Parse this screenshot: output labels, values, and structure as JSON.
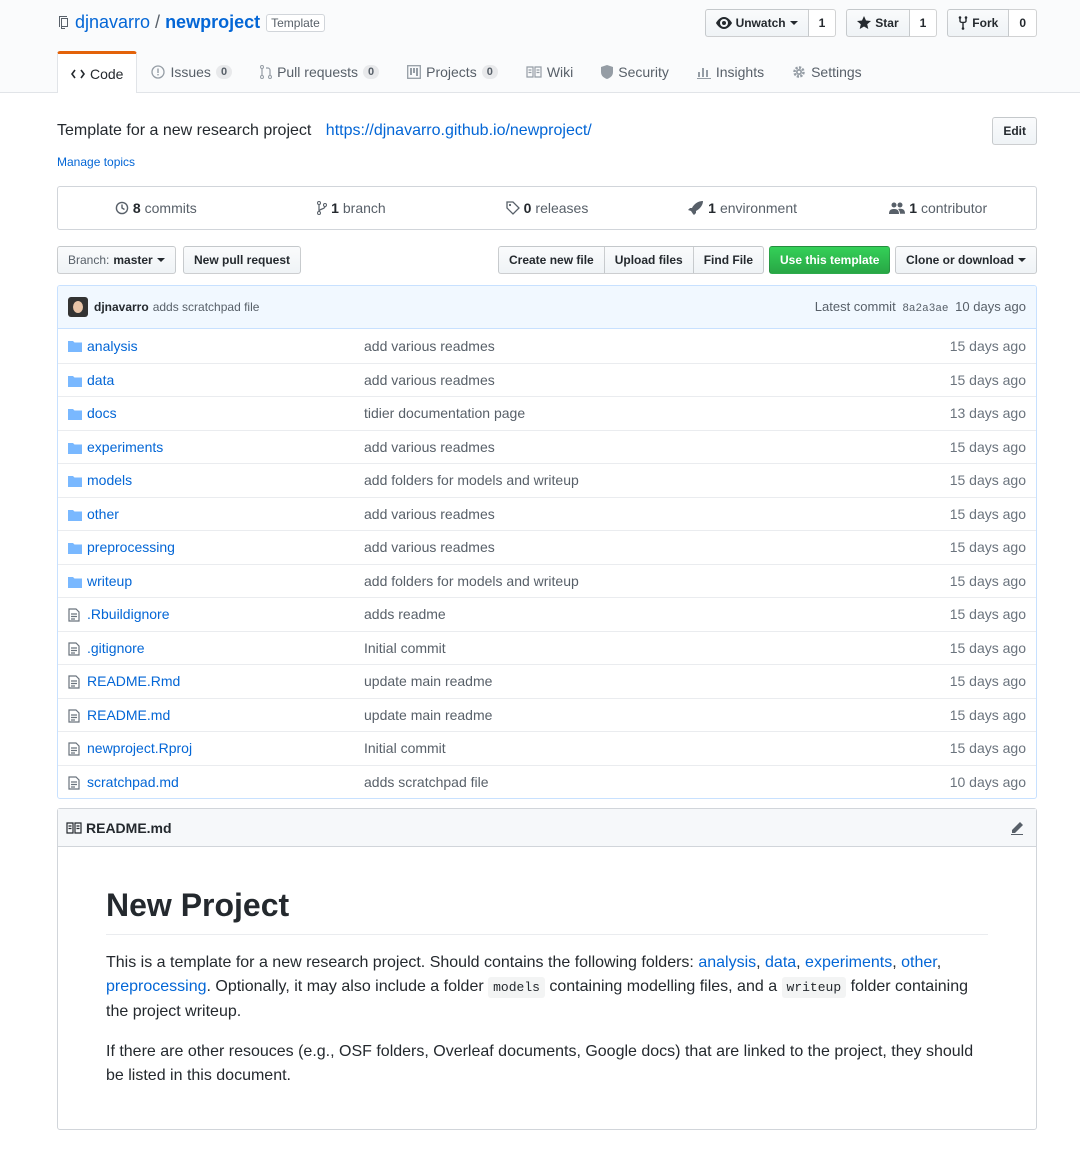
{
  "repo": {
    "owner": "djnavarro",
    "separator": "/",
    "name": "newproject",
    "template_badge": "Template"
  },
  "actions": {
    "watch_label": "Unwatch",
    "watch_count": "1",
    "star_label": "Star",
    "star_count": "1",
    "fork_label": "Fork",
    "fork_count": "0"
  },
  "tabs": [
    {
      "label": "Code",
      "icon": "code-icon"
    },
    {
      "label": "Issues",
      "count": "0",
      "icon": "issue-icon"
    },
    {
      "label": "Pull requests",
      "count": "0",
      "icon": "pull-request-icon"
    },
    {
      "label": "Projects",
      "count": "0",
      "icon": "project-icon"
    },
    {
      "label": "Wiki",
      "icon": "book-icon"
    },
    {
      "label": "Security",
      "icon": "shield-icon"
    },
    {
      "label": "Insights",
      "icon": "graph-icon"
    },
    {
      "label": "Settings",
      "icon": "gear-icon"
    }
  ],
  "about": {
    "description": "Template for a new research project",
    "url": "https://djnavarro.github.io/newproject/",
    "manage_topics": "Manage topics",
    "edit_label": "Edit"
  },
  "summary": {
    "commits_num": "8",
    "commits_label": "commits",
    "branches_num": "1",
    "branches_label": "branch",
    "releases_num": "0",
    "releases_label": "releases",
    "environments_num": "1",
    "environments_label": "environment",
    "contributors_num": "1",
    "contributors_label": "contributor"
  },
  "toolbar": {
    "branch_prefix": "Branch:",
    "branch_name": "master",
    "new_pr": "New pull request",
    "create_file": "Create new file",
    "upload_files": "Upload files",
    "find_file": "Find File",
    "use_template": "Use this template",
    "clone": "Clone or download"
  },
  "latest_commit": {
    "author": "djnavarro",
    "message": "adds scratchpad file",
    "prefix": "Latest commit",
    "sha": "8a2a3ae",
    "age": "10 days ago"
  },
  "files": [
    {
      "type": "dir",
      "name": "analysis",
      "message": "add various readmes",
      "age": "15 days ago"
    },
    {
      "type": "dir",
      "name": "data",
      "message": "add various readmes",
      "age": "15 days ago"
    },
    {
      "type": "dir",
      "name": "docs",
      "message": "tidier documentation page",
      "age": "13 days ago"
    },
    {
      "type": "dir",
      "name": "experiments",
      "message": "add various readmes",
      "age": "15 days ago"
    },
    {
      "type": "dir",
      "name": "models",
      "message": "add folders for models and writeup",
      "age": "15 days ago"
    },
    {
      "type": "dir",
      "name": "other",
      "message": "add various readmes",
      "age": "15 days ago"
    },
    {
      "type": "dir",
      "name": "preprocessing",
      "message": "add various readmes",
      "age": "15 days ago"
    },
    {
      "type": "dir",
      "name": "writeup",
      "message": "add folders for models and writeup",
      "age": "15 days ago"
    },
    {
      "type": "file",
      "name": ".Rbuildignore",
      "message": "adds readme",
      "age": "15 days ago"
    },
    {
      "type": "file",
      "name": ".gitignore",
      "message": "Initial commit",
      "age": "15 days ago"
    },
    {
      "type": "file",
      "name": "README.Rmd",
      "message": "update main readme",
      "age": "15 days ago"
    },
    {
      "type": "file",
      "name": "README.md",
      "message": "update main readme",
      "age": "15 days ago"
    },
    {
      "type": "file",
      "name": "newproject.Rproj",
      "message": "Initial commit",
      "age": "15 days ago"
    },
    {
      "type": "file",
      "name": "scratchpad.md",
      "message": "adds scratchpad file",
      "age": "10 days ago"
    }
  ],
  "readme": {
    "filename": "README.md",
    "heading": "New Project",
    "p1_a": "This is a template for a new research project. Should contains the following folders: ",
    "p1_links": [
      "analysis",
      "data",
      "experiments",
      "other",
      "preprocessing"
    ],
    "p1_b": ". Optionally, it may also include a folder ",
    "p1_code1": "models",
    "p1_c": " containing modelling files, and a ",
    "p1_code2": "writeup",
    "p1_d": " folder containing the project writeup.",
    "p2": "If there are other resouces (e.g., OSF folders, Overleaf documents, Google docs) that are linked to the project, they should be listed in this document."
  },
  "colors": {
    "link": "#0366d6",
    "accent_tab": "#e36209",
    "primary_button": "#28a745"
  }
}
